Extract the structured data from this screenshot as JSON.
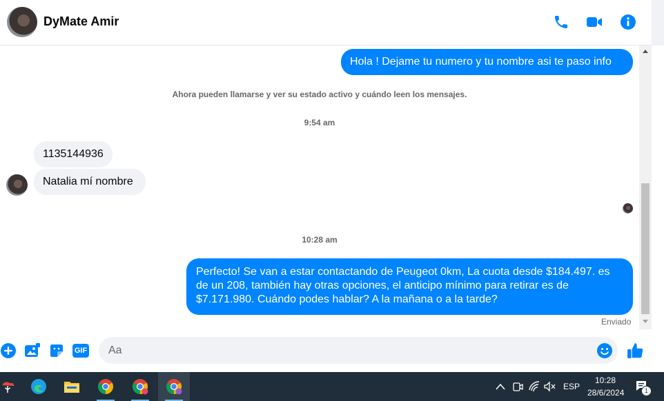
{
  "header": {
    "contact_name": "DyMate Amir",
    "icons": [
      "phone-icon",
      "video-icon",
      "info-icon"
    ],
    "accent_color": "#0084ff"
  },
  "messages": {
    "out_1": "Hola  ! Dejame tu numero y tu nombre asi te paso info",
    "system_note": "Ahora pueden llamarse y ver su estado activo y cuándo leen los mensajes.",
    "time_1": "9:54 am",
    "in_1": "1135144936",
    "in_2": "Natalia mí nombre",
    "time_2": "10:28 am",
    "out_2_line_1": "Perfecto!  Se van a estar contactando de Peugeot 0km, La cuota desde $184.497. es",
    "out_2_line_2": "de un 208, también hay otras opciones, el anticipo mínimo para retirar es de",
    "out_2_line_3": "$7.171.980. Cuándo podes hablar? A la mañana o a la tarde?",
    "status": "Enviado"
  },
  "composer": {
    "placeholder": "Aa",
    "gif_label": "GIF"
  },
  "taskbar": {
    "language": "ESP",
    "time": "10:28",
    "date": "28/6/2024",
    "notification_count": "1"
  }
}
